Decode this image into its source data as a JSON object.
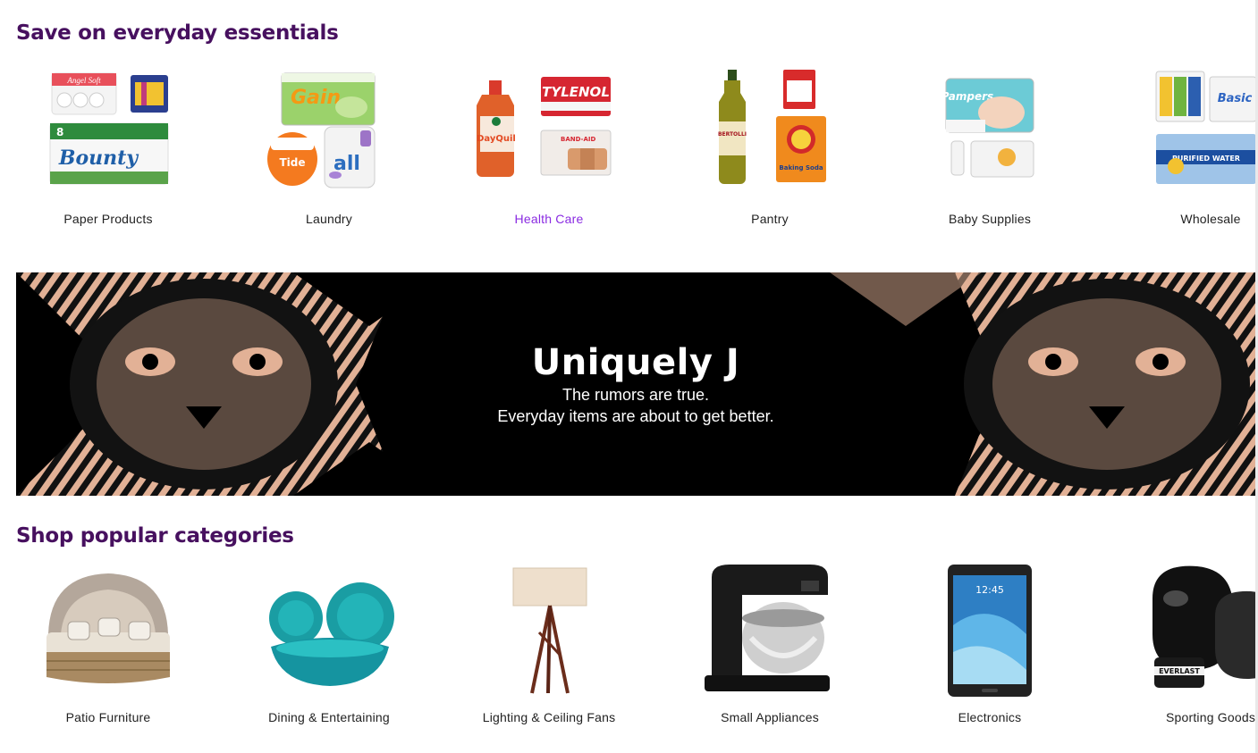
{
  "sections": {
    "essentials_title": "Save on everyday essentials",
    "popular_title": "Shop popular categories"
  },
  "essentials": [
    {
      "label": "Paper Products",
      "icon": "paper-products-image"
    },
    {
      "label": "Laundry",
      "icon": "laundry-image"
    },
    {
      "label": "Health Care",
      "icon": "health-care-image"
    },
    {
      "label": "Pantry",
      "icon": "pantry-image"
    },
    {
      "label": "Baby Supplies",
      "icon": "baby-supplies-image"
    },
    {
      "label": "Wholesale",
      "icon": "wholesale-image"
    }
  ],
  "banner": {
    "title": "Uniquely J",
    "line1": "The rumors are true.",
    "line2": "Everyday items are about to get better."
  },
  "popular": [
    {
      "label": "Patio Furniture",
      "icon": "patio-daybed-image"
    },
    {
      "label": "Dining & Entertaining",
      "icon": "teal-dinnerware-image"
    },
    {
      "label": "Lighting & Ceiling Fans",
      "icon": "floor-lamp-image"
    },
    {
      "label": "Small Appliances",
      "icon": "stand-mixer-image"
    },
    {
      "label": "Electronics",
      "icon": "tablet-image"
    },
    {
      "label": "Sporting Goods",
      "icon": "boxing-gloves-image"
    }
  ],
  "product_text": {
    "angel_soft": "Angel Soft",
    "bounty": "Bounty",
    "gain": "Gain",
    "tide": "Tide",
    "all": "all",
    "tylenol": "TYLENOL",
    "dayquil": "DayQuil",
    "band_aid": "BAND-AID",
    "bertolli": "BERTOLLI",
    "baking_soda": "Baking Soda",
    "pampers": "Pampers",
    "basic": "Basic",
    "water": "PURIFIED WATER",
    "tablet_time": "12:45",
    "everlast": "EVERLAST"
  },
  "colors": {
    "heading": "#47105f",
    "active_link": "#8a2be2",
    "banner_bg": "#000000",
    "banner_pattern": "#e2b196"
  }
}
